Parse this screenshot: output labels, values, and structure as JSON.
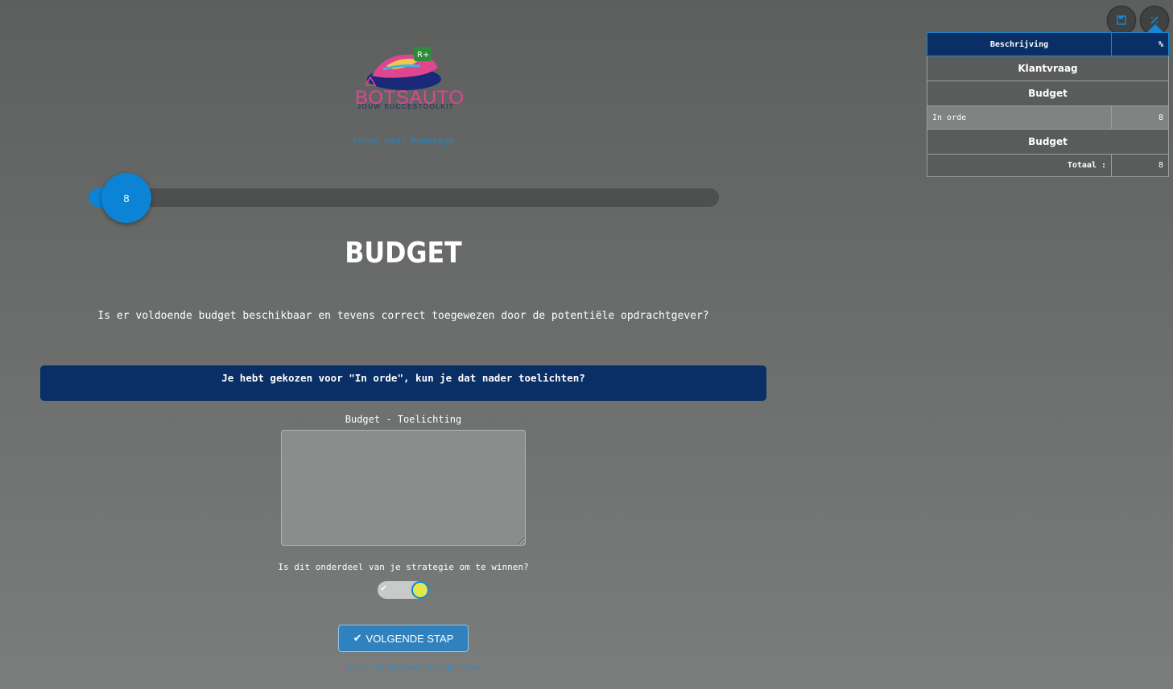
{
  "toolbar": {
    "save_icon": "save-icon",
    "tool_icon": "magic-wand-icon"
  },
  "score_table": {
    "header": {
      "description": "Beschrijving",
      "percent": "%"
    },
    "sections": [
      {
        "title": "Klantvraag"
      },
      {
        "title": "Budget",
        "rows": [
          {
            "label": "In orde",
            "value": "8"
          }
        ]
      },
      {
        "title": "Budget"
      }
    ],
    "total": {
      "label": "Totaal :",
      "value": "8"
    }
  },
  "logo": {
    "title": "BOTSAUTO",
    "subtitle": "JOUW SUCCESTOOLKIT"
  },
  "home_link": "terug naar homepage",
  "slider": {
    "value": "8",
    "min": 0,
    "max": 100,
    "fraction": 0.02
  },
  "page": {
    "title": "BUDGET",
    "question": "Is er voldoende budget beschikbaar en tevens correct toegewezen door de potentiële opdrachtgever?",
    "banner": "Je hebt gekozen voor \"In orde\", kun je dat nader toelichten?",
    "textarea_label": "Budget - Toelichting",
    "textarea_value": "",
    "strategy_question": "Is dit onderdeel van je strategie om te winnen?",
    "strategy_toggle": true,
    "next_button": "VOLGENDE STAP",
    "back_link": "terug naar vorige stap"
  },
  "colors": {
    "accent": "#0b84d6",
    "banner": "#0a2f66",
    "logo_pink": "#e0468f"
  }
}
